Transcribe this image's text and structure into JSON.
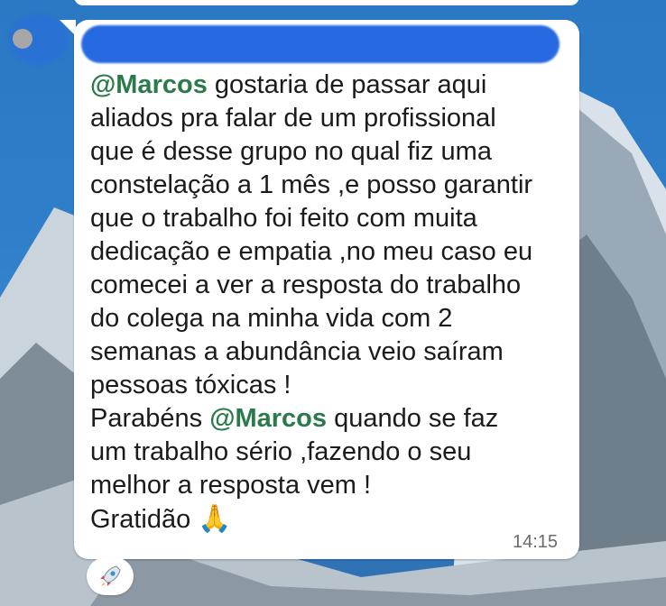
{
  "message": {
    "mention_1": "@Marcos",
    "line_1_text": " gostaria de passar aqui",
    "line_2": "aliados pra falar de um profissional",
    "line_3": "que é desse grupo no qual fiz uma",
    "line_4": "constelação a 1 mês ,e posso garantir",
    "line_5": "que o trabalho foi feito com muita",
    "line_6": "dedicação e empatia ,no meu caso eu",
    "line_7": "comecei a ver a resposta do trabalho",
    "line_8": "do colega na minha vida com 2",
    "line_9": "semanas a abundância veio saíram",
    "line_10": "pessoas tóxicas !",
    "line_11_prefix": "Parabéns ",
    "mention_2": "@Marcos",
    "line_11_suffix": " quando se faz",
    "line_12": "um trabalho sério ,fazendo o seu",
    "line_13": "melhor a resposta vem !",
    "line_14": "Gratidão ",
    "emoji_praying_hands": "🙏",
    "time": "14:15"
  },
  "reaction": {
    "emoji": "🚀",
    "icon": "rocket-icon"
  },
  "colors": {
    "mention": "#2a7a4b",
    "bubble": "#ffffff",
    "text": "#1b1b1b",
    "time": "#6a6a6a",
    "wallpaper_sky": "#2f7fca",
    "redaction": "#2669e0"
  }
}
